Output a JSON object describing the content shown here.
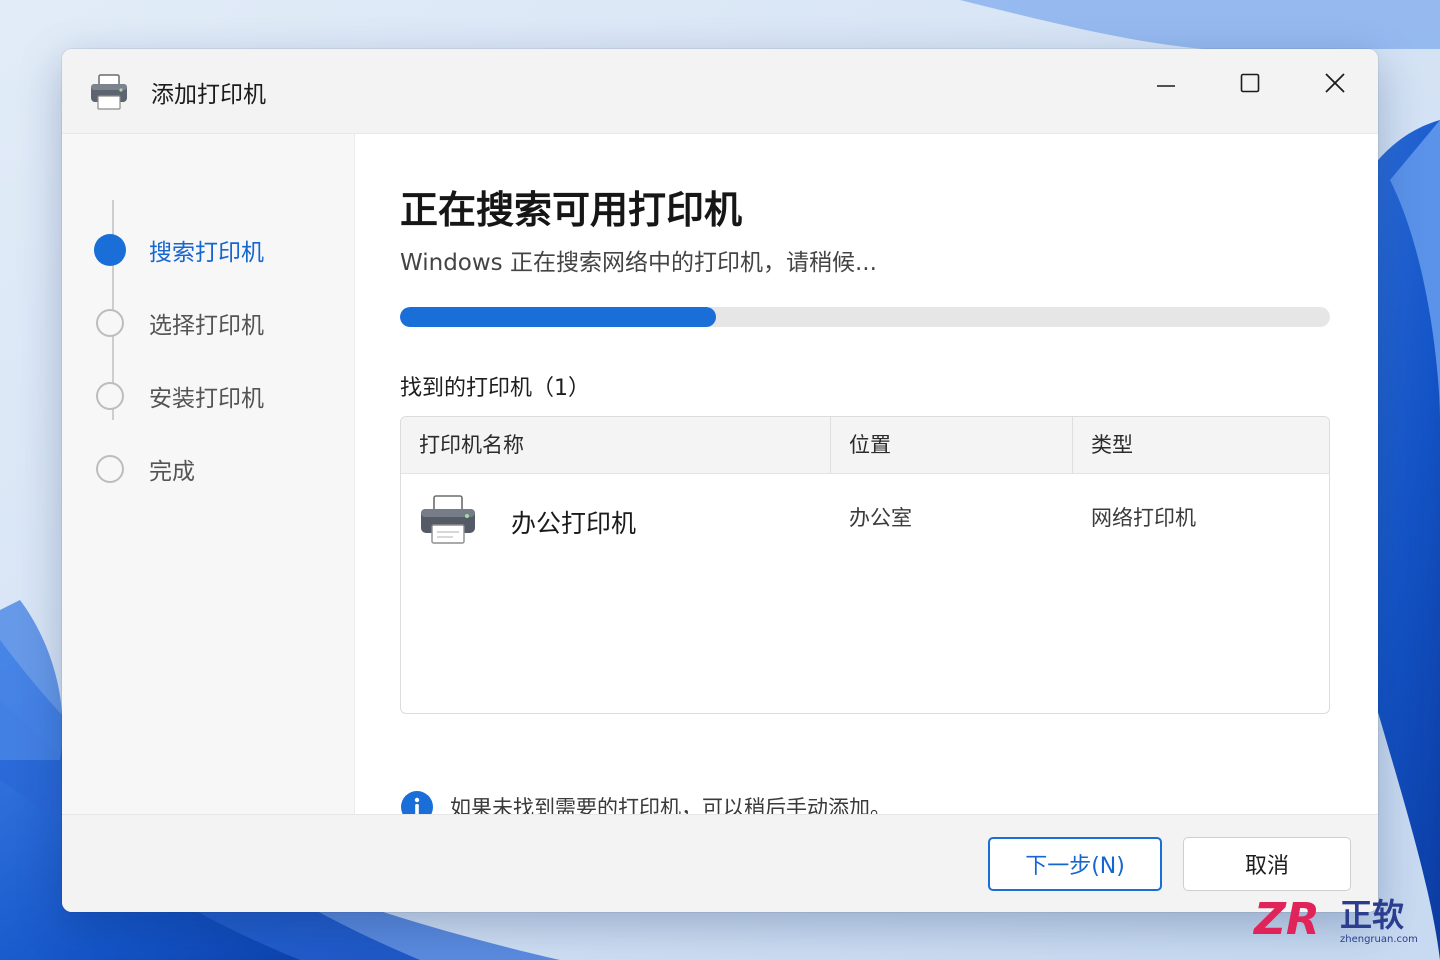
{
  "window": {
    "title": "添加打印机",
    "controls": {
      "minimize": "minimize",
      "maximize": "maximize",
      "close": "close"
    }
  },
  "sidebar": {
    "steps": [
      {
        "label": "搜索打印机",
        "state": "active"
      },
      {
        "label": "选择打印机",
        "state": "pending"
      },
      {
        "label": "安装打印机",
        "state": "pending"
      },
      {
        "label": "完成",
        "state": "pending"
      }
    ]
  },
  "main": {
    "title": "正在搜索可用打印机",
    "subtitle": "Windows 正在搜索网络中的打印机，请稍候...",
    "progress": 0.34,
    "found_heading": "找到的打印机（1）",
    "table": {
      "columns": [
        "打印机名称",
        "位置",
        "类型"
      ],
      "rows": [
        {
          "icon": "printer-icon",
          "name": "办公打印机",
          "location": "办公室",
          "type": "网络打印机"
        }
      ]
    },
    "info_text": "如果未找到需要的打印机，可以稍后手动添加。"
  },
  "footer": {
    "next_label": "下一步(N)",
    "cancel_label": "取消"
  },
  "watermark": {
    "brand": "正软",
    "domain": "zhengruan.com"
  },
  "colors": {
    "accent": "#1a6ed8",
    "accent_text": "#1566d1",
    "watermark": "#e0245a"
  }
}
